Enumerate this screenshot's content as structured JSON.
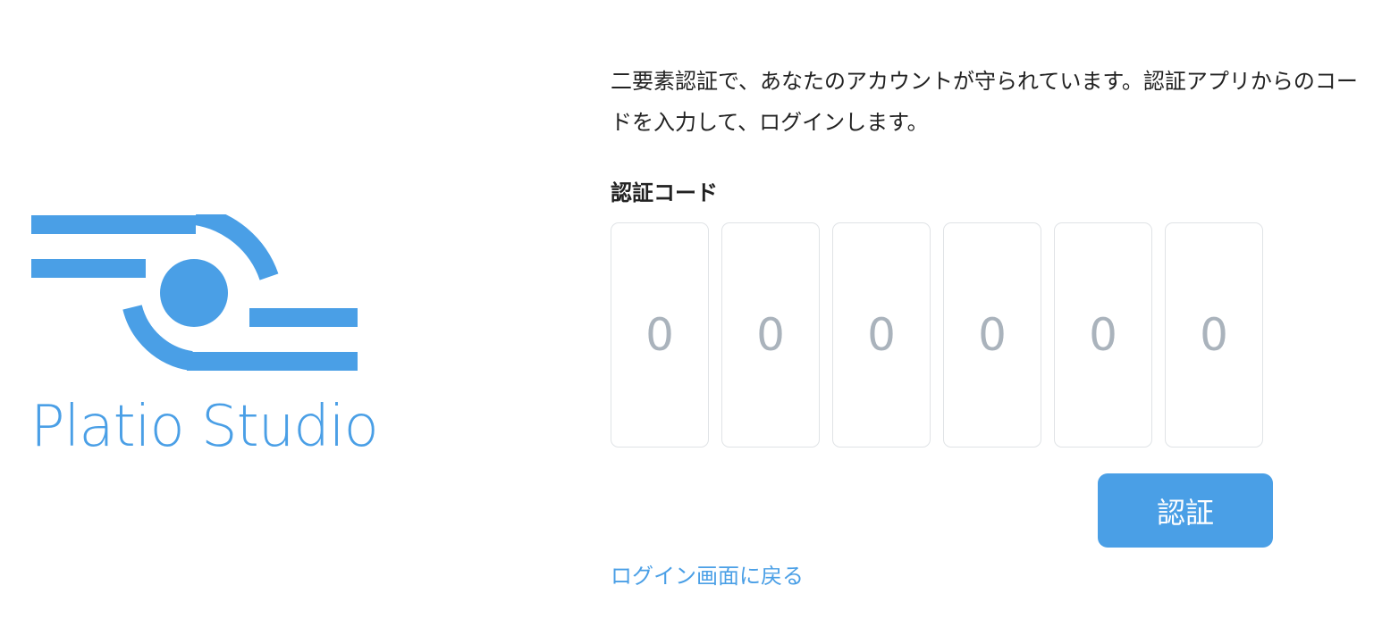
{
  "brand": {
    "name": "Platio Studio",
    "color": "#4a9fe6",
    "logo_icon": "platio-logo-icon"
  },
  "form": {
    "description": "二要素認証で、あなたのアカウントが守られています。認証アプリからのコードを入力して、ログインします。",
    "code_label": "認証コード",
    "code_digits": [
      {
        "placeholder": "0",
        "value": ""
      },
      {
        "placeholder": "0",
        "value": ""
      },
      {
        "placeholder": "0",
        "value": ""
      },
      {
        "placeholder": "0",
        "value": ""
      },
      {
        "placeholder": "0",
        "value": ""
      },
      {
        "placeholder": "0",
        "value": ""
      }
    ],
    "submit_label": "認証",
    "back_link_label": "ログイン画面に戻る",
    "accent_color": "#4a9fe6"
  }
}
